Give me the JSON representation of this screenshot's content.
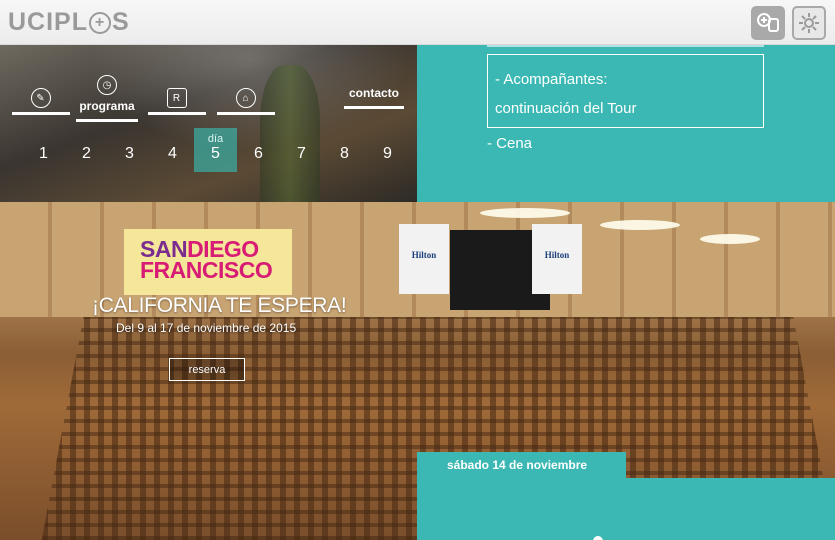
{
  "header": {
    "logo_text_a": "UCIPL",
    "logo_plus": "+",
    "logo_text_b": "S",
    "login_icon": "user-add-icon",
    "settings_icon": "gear-icon"
  },
  "nav": {
    "items": [
      {
        "icon": "pen-icon",
        "glyph": "✎"
      },
      {
        "label": "programa",
        "icon": "clock-icon",
        "glyph": "◷"
      },
      {
        "icon": "r-badge-icon",
        "glyph": "R"
      },
      {
        "icon": "home-icon",
        "glyph": "⌂"
      },
      {
        "label": "contacto"
      }
    ],
    "day_label": "día",
    "days": [
      "1",
      "2",
      "3",
      "4",
      "5",
      "6",
      "7",
      "8",
      "9"
    ],
    "active_day": "5"
  },
  "info": {
    "line1": "- Acompañantes:",
    "line2": "continuación del Tour",
    "line3": "- Cena"
  },
  "hero": {
    "brand_san": "SAN",
    "brand_diego": "DIEGO",
    "brand_francisco": "FRANCISCO",
    "tagline": "¡CALIFORNIA TE ESPERA!",
    "dates": "Del 9 al 17 de noviembre de 2015",
    "reserva_label": "reserva",
    "banner_text": "Hilton",
    "date_chip": "sábado 14 de noviembre"
  },
  "colors": {
    "teal": "#3bb8b3",
    "logo_bg": "#f4e79a",
    "purple": "#7a2d8f",
    "magenta": "#d81b74"
  }
}
